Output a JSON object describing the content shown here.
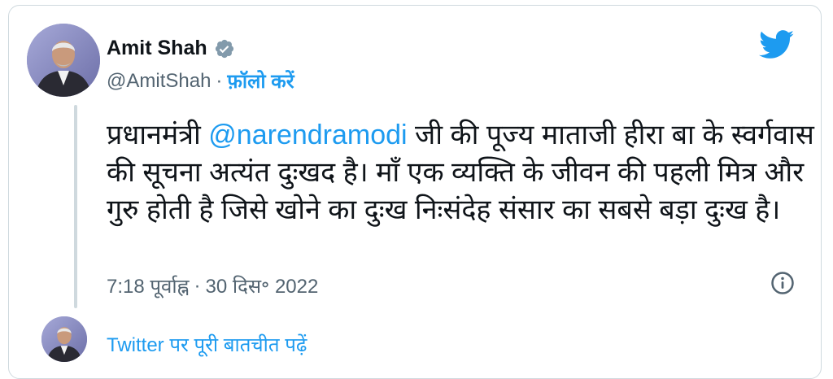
{
  "author": {
    "name": "Amit Shah",
    "handle": "@AmitShah",
    "separator": "·",
    "follow_label": "फ़ॉलो करें",
    "verified": true
  },
  "tweet": {
    "text_before_mention": "प्रधानमंत्री ",
    "mention": "@narendramodi",
    "text_after_mention": " जी की पूज्य माताजी हीरा बा के स्वर्गवास की सूचना अत्यंत दुःखद है। माँ एक व्यक्ति के जीवन की पहली मित्र और गुरु होती है जिसे खोने का दुःख निःसंदेह संसार का सबसे बड़ा दुःख है।"
  },
  "meta": {
    "time": "7:18 पूर्वाह्न",
    "separator": "·",
    "date": "30 दिस॰ 2022"
  },
  "thread_link_label": "Twitter पर पूरी बातचीत पढ़ें",
  "icons": {
    "brand": "twitter-bird-icon",
    "verified": "verified-badge-icon",
    "info": "info-icon"
  },
  "colors": {
    "accent": "#1d9bf0",
    "text": "#0f1419",
    "muted": "#536471",
    "border": "#cfd9de",
    "verified_badge": "#829aab"
  }
}
